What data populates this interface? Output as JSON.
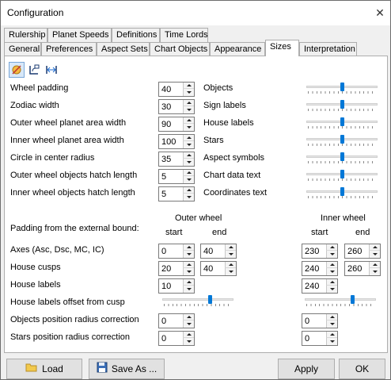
{
  "window": {
    "title": "Configuration",
    "close_glyph": "✕"
  },
  "tabs_row1": [
    "Rulership",
    "Planet Speeds",
    "Definitions",
    "Time Lords"
  ],
  "tabs_row2": [
    "General",
    "Preferences",
    "Aspect Sets",
    "Chart Objects",
    "Appearance",
    "Sizes",
    "Interpretation"
  ],
  "active_tab": "Sizes",
  "toolbar": {
    "icons": [
      "planet-size-icon",
      "radius-icon",
      "width-icon"
    ]
  },
  "left_params": [
    {
      "label": "Wheel padding",
      "value": "40"
    },
    {
      "label": "Zodiac width",
      "value": "30"
    },
    {
      "label": "Outer wheel planet area width",
      "value": "90"
    },
    {
      "label": "Inner wheel planet area width",
      "value": "100"
    },
    {
      "label": "Circle in center radius",
      "value": "35"
    },
    {
      "label": "Outer wheel objects hatch length",
      "value": "5"
    },
    {
      "label": "Inner wheel objects hatch length",
      "value": "5"
    }
  ],
  "right_sliders": [
    {
      "label": "Objects",
      "level": 0.5
    },
    {
      "label": "Sign labels",
      "level": 0.5
    },
    {
      "label": "House labels",
      "level": 0.5
    },
    {
      "label": "Stars",
      "level": 0.5
    },
    {
      "label": "Aspect symbols",
      "level": 0.5
    },
    {
      "label": "Chart data text",
      "level": 0.5
    },
    {
      "label": "Coordinates text",
      "level": 0.5
    }
  ],
  "padding": {
    "title": "Padding from the external bound:",
    "outer_label": "Outer wheel",
    "inner_label": "Inner wheel",
    "start_label": "start",
    "end_label": "end",
    "rows": [
      {
        "label": "Axes (Asc, Dsc, MC, IC)",
        "outer_start": "0",
        "outer_end": "40",
        "inner_start": "230",
        "inner_end": "260"
      },
      {
        "label": "House cusps",
        "outer_start": "20",
        "outer_end": "40",
        "inner_start": "240",
        "inner_end": "260"
      },
      {
        "label": "House labels",
        "outer_start": "10",
        "inner_start": "240"
      }
    ],
    "offset_label": "House labels offset from cusp",
    "offset_outer_level": 0.68,
    "offset_inner_level": 0.68,
    "objects_corr_label": "Objects position radius correction",
    "objects_corr_outer": "0",
    "objects_corr_inner": "0",
    "stars_corr_label": "Stars position radius correction",
    "stars_corr_outer": "0",
    "stars_corr_inner": "0"
  },
  "buttons": {
    "load": "Load",
    "save_as": "Save As ...",
    "apply": "Apply",
    "ok": "OK"
  },
  "colors": {
    "accent": "#0078d7"
  }
}
